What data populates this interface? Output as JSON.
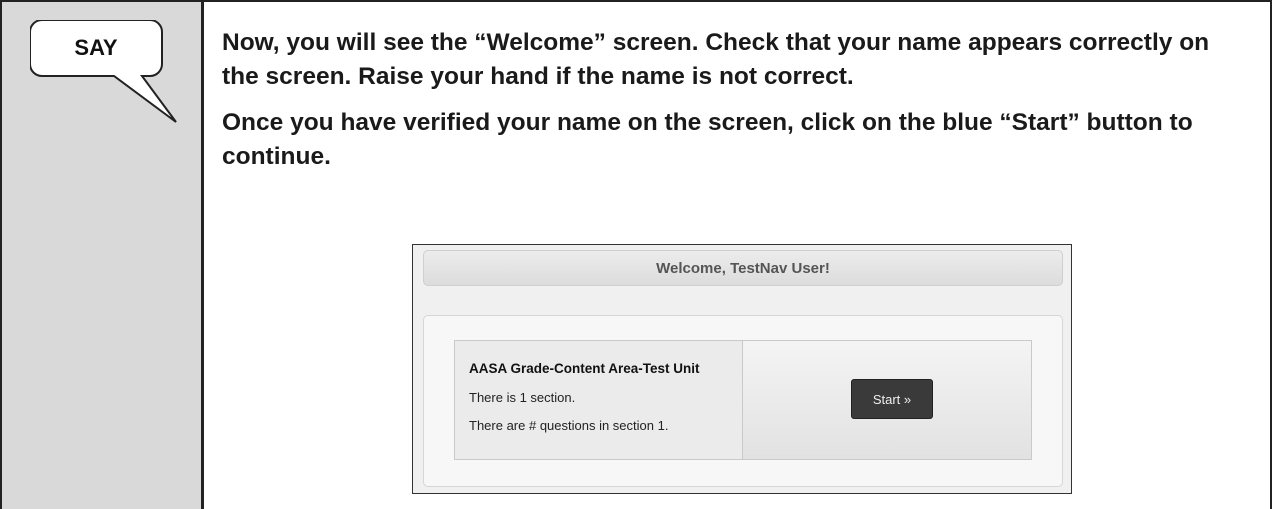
{
  "say_label": "SAY",
  "paragraphs": [
    "Now, you will see the “Welcome” screen. Check that your name appears correctly on the screen. Raise your hand if the name is not correct.",
    "Once you have verified your name on the screen, click on the blue “Start” button to continue."
  ],
  "screenshot": {
    "header": "Welcome, TestNav User!",
    "unit_title": "AASA Grade-Content Area-Test Unit",
    "section_count_text": "There is 1 section.",
    "question_count_text": "There are # questions in section 1.",
    "start_button": "Start »"
  }
}
